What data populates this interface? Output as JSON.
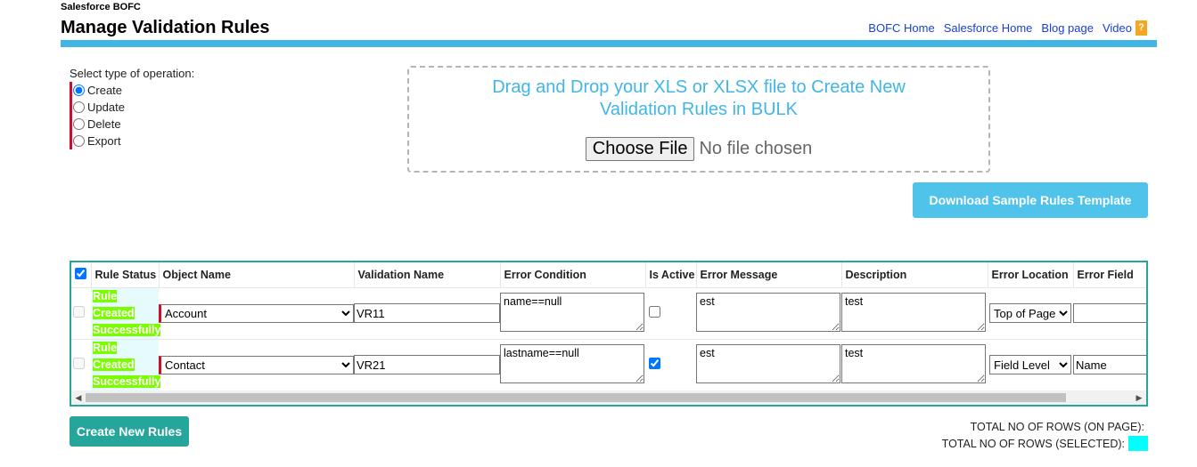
{
  "app_label": "Salesforce BOFC",
  "page_title": "Manage Validation Rules",
  "top_links": [
    "BOFC Home",
    "Salesforce Home",
    "Blog page",
    "Video"
  ],
  "help_icon": "?",
  "accent_color": "#41b6e6",
  "operation": {
    "label": "Select type of operation:",
    "options": [
      "Create",
      "Update",
      "Delete",
      "Export"
    ],
    "selected": "Create"
  },
  "dropzone": {
    "text": "Drag and Drop your XLS or XLSX file to Create New Validation Rules in BULK",
    "choose_label": "Choose File",
    "no_file": "No file chosen"
  },
  "download_button": "Download Sample Rules Template",
  "table": {
    "columns": [
      "Rule Status",
      "Object Name",
      "Validation Name",
      "Error Condition",
      "Is Active",
      "Error Message",
      "Description",
      "Error Location",
      "Error Field"
    ],
    "rows": [
      {
        "status": [
          "Rule",
          "Created",
          "Successfully"
        ],
        "object": "Account",
        "validation_name": "VR11",
        "error_condition": "name==null",
        "is_active": false,
        "error_message": "est",
        "description": "test",
        "error_location": "Top of Page",
        "error_field": ""
      },
      {
        "status": [
          "Rule",
          "Created",
          "Successfully"
        ],
        "object": "Contact",
        "validation_name": "VR21",
        "error_condition": "lastname==null",
        "is_active": true,
        "error_message": "est",
        "description": "test",
        "error_location": "Field Level",
        "error_field": "Name"
      }
    ]
  },
  "create_button": "Create New Rules",
  "totals": {
    "on_page": "TOTAL NO OF ROWS (ON PAGE):",
    "selected": "TOTAL NO OF ROWS (SELECTED):"
  }
}
